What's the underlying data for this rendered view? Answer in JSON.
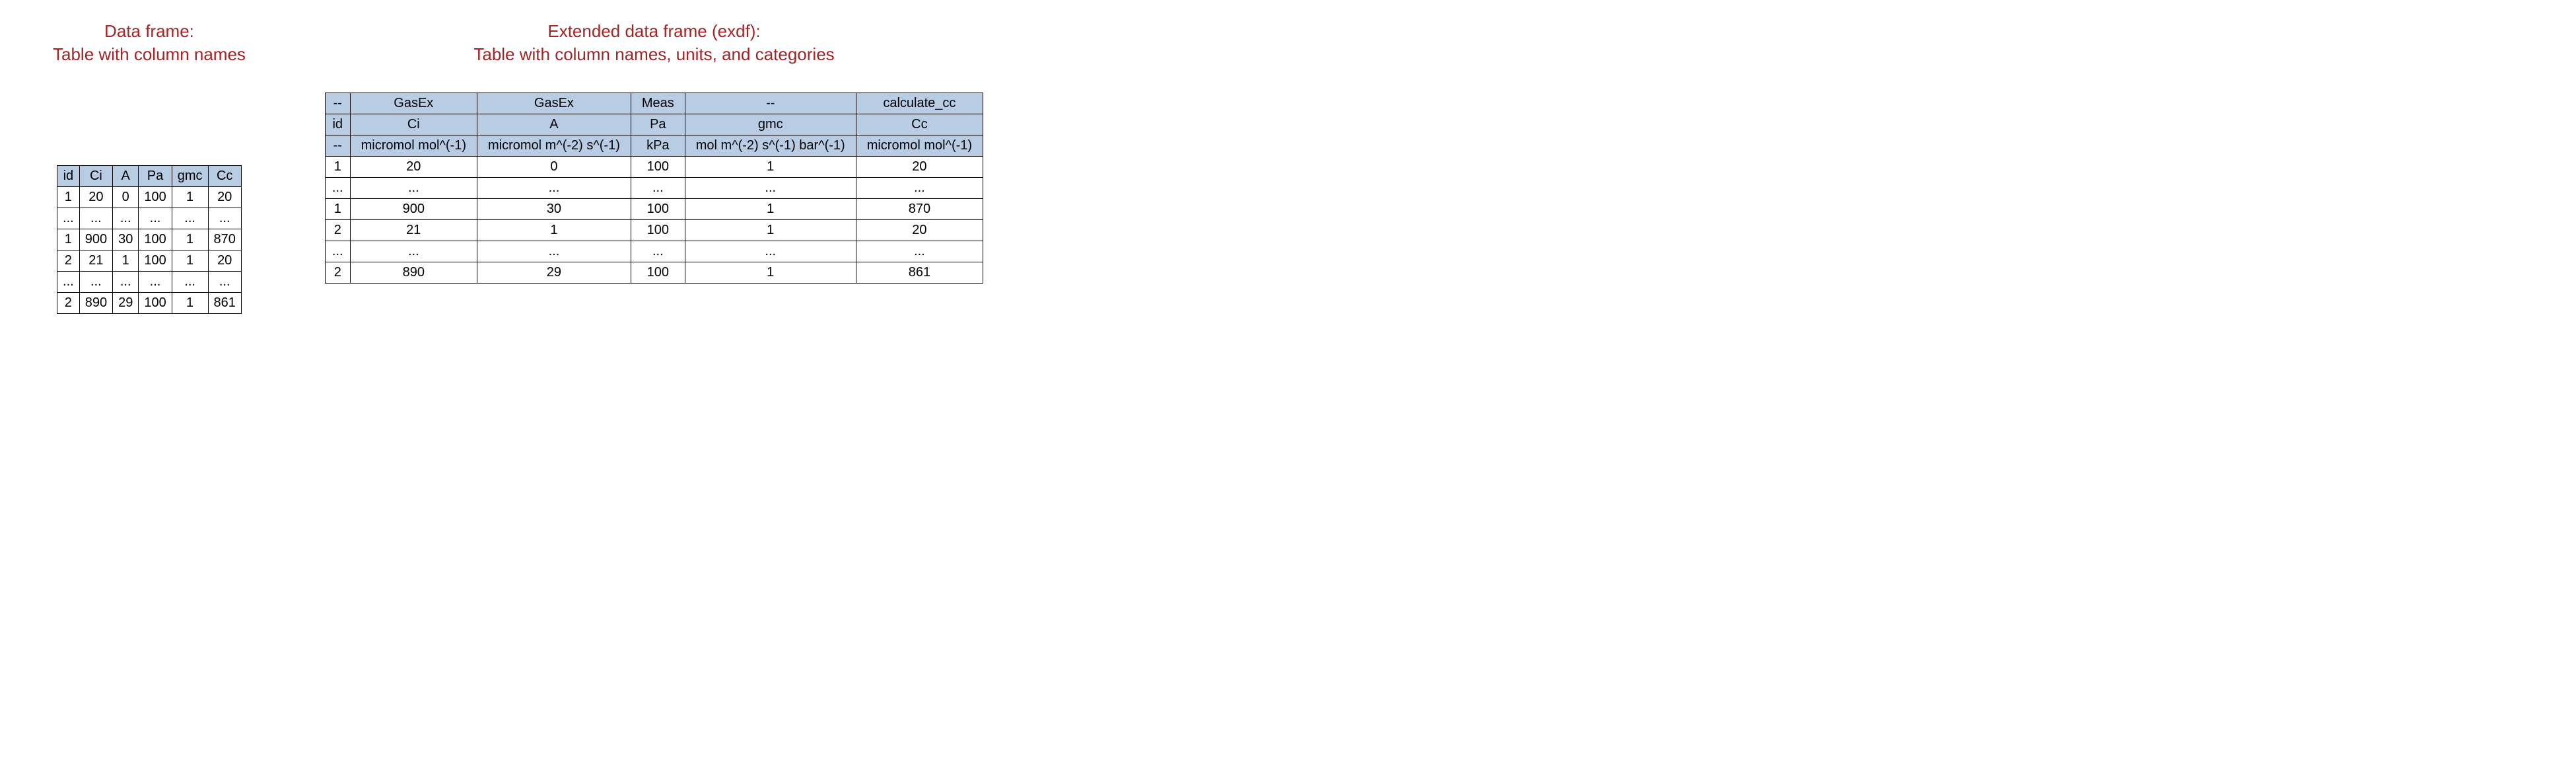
{
  "left": {
    "title": "Data frame:\nTable with column names",
    "headers": [
      "id",
      "Ci",
      "A",
      "Pa",
      "gmc",
      "Cc"
    ],
    "rows": [
      [
        "1",
        "20",
        "0",
        "100",
        "1",
        "20"
      ],
      [
        "...",
        "...",
        "...",
        "...",
        "...",
        "..."
      ],
      [
        "1",
        "900",
        "30",
        "100",
        "1",
        "870"
      ],
      [
        "2",
        "21",
        "1",
        "100",
        "1",
        "20"
      ],
      [
        "...",
        "...",
        "...",
        "...",
        "...",
        "..."
      ],
      [
        "2",
        "890",
        "29",
        "100",
        "1",
        "861"
      ]
    ]
  },
  "right": {
    "title": "Extended data frame (exdf):\nTable with column names, units, and categories",
    "categories": [
      "--",
      "GasEx",
      "GasEx",
      "Meas",
      "--",
      "calculate_cc"
    ],
    "names": [
      "id",
      "Ci",
      "A",
      "Pa",
      "gmc",
      "Cc"
    ],
    "units": [
      "--",
      "micromol mol^(-1)",
      "micromol m^(-2) s^(-1)",
      "kPa",
      "mol m^(-2) s^(-1) bar^(-1)",
      "micromol mol^(-1)"
    ],
    "rows": [
      [
        "1",
        "20",
        "0",
        "100",
        "1",
        "20"
      ],
      [
        "...",
        "...",
        "...",
        "...",
        "...",
        "..."
      ],
      [
        "1",
        "900",
        "30",
        "100",
        "1",
        "870"
      ],
      [
        "2",
        "21",
        "1",
        "100",
        "1",
        "20"
      ],
      [
        "...",
        "...",
        "...",
        "...",
        "...",
        "..."
      ],
      [
        "2",
        "890",
        "29",
        "100",
        "1",
        "861"
      ]
    ]
  }
}
